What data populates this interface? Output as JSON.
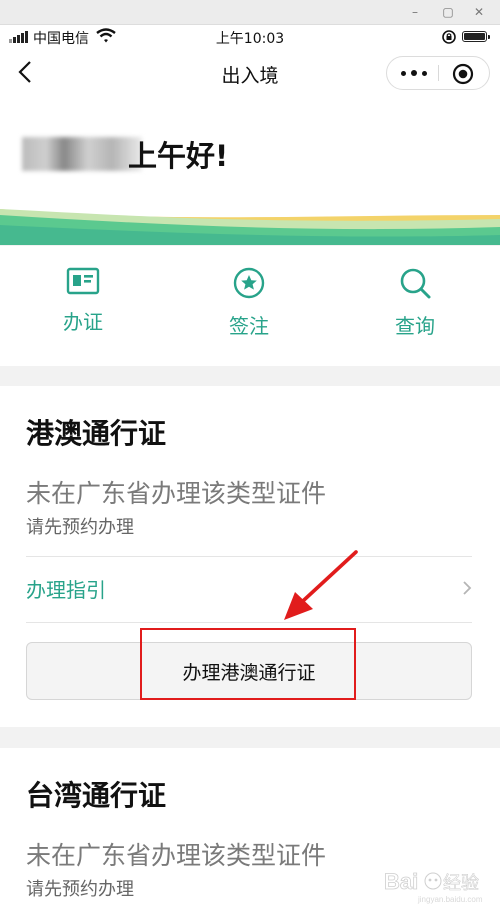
{
  "status_bar": {
    "carrier": "中国电信",
    "time": "上午10:03"
  },
  "navbar": {
    "title": "出入境"
  },
  "greeting": {
    "text": "上午好!"
  },
  "quick_actions": [
    {
      "label": "办证",
      "icon": "id-card-icon"
    },
    {
      "label": "签注",
      "icon": "star-badge-icon"
    },
    {
      "label": "查询",
      "icon": "search-icon"
    }
  ],
  "cards": {
    "hk_macau": {
      "title": "港澳通行证",
      "status": "未在广东省办理该类型证件",
      "note": "请先预约办理",
      "guide_label": "办理指引",
      "apply_label": "办理港澳通行证"
    },
    "taiwan": {
      "title": "台湾通行证",
      "status": "未在广东省办理该类型证件",
      "note": "请先预约办理"
    }
  },
  "colors": {
    "accent_green": "#28a38a",
    "wave_green": "#5bc98f",
    "wave_yellow": "#f3d36a",
    "annotation_red": "#e11c1c"
  }
}
